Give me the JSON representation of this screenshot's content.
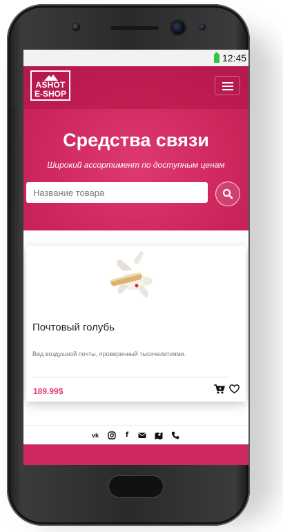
{
  "status_bar": {
    "time": "12:45",
    "battery_color": "#35c24a"
  },
  "logo": {
    "line1": "ASHOT",
    "line2": "E-SHOP"
  },
  "hero": {
    "title": "Средства связи",
    "subtitle": "Широкий ассортимент по доступным ценам",
    "bg_color": "#cf2a5f"
  },
  "search": {
    "placeholder": "Название товара",
    "value": ""
  },
  "product": {
    "name": "Почтовый голубь",
    "description": "Вид воздушной почты, проверенный тысячелетиями.",
    "price": "189.99$",
    "price_color": "#e23a6c",
    "image_icon": "dove-with-letter"
  },
  "social_icons": [
    "vk-icon",
    "instagram-icon",
    "facebook-icon",
    "mail-icon",
    "map-icon",
    "phone-icon"
  ]
}
